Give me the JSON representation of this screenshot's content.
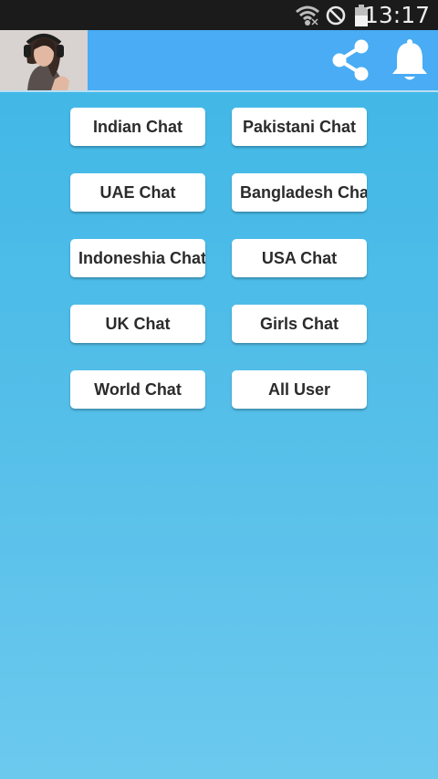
{
  "status_bar": {
    "time": "13:17",
    "icons": [
      "wifi-icon",
      "no-sim-icon",
      "battery-icon"
    ],
    "background": "#1b1b1b"
  },
  "app_bar": {
    "color": "#49acf4",
    "avatar": "profile-photo",
    "actions": [
      "share-icon",
      "bell-icon"
    ]
  },
  "buttons": [
    {
      "label": "Indian Chat"
    },
    {
      "label": "Pakistani Chat"
    },
    {
      "label": "UAE Chat"
    },
    {
      "label": "Bangladesh Chat"
    },
    {
      "label": "Indoneshia Chat"
    },
    {
      "label": "USA Chat"
    },
    {
      "label": "UK Chat"
    },
    {
      "label": "Girls Chat"
    },
    {
      "label": "World Chat"
    },
    {
      "label": "All User"
    }
  ],
  "colors": {
    "background_top": "#3db6e6",
    "background_bottom": "#6cc9ee",
    "button": "#ffffff",
    "button_text": "#2b2b2b"
  }
}
